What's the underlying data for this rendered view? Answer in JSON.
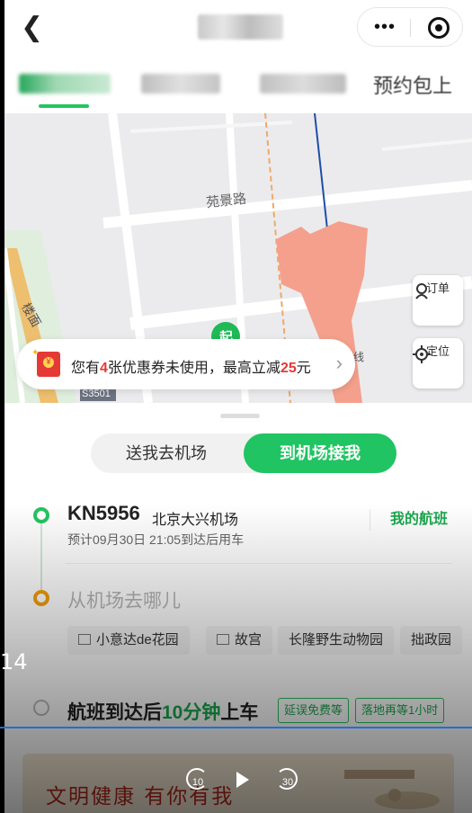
{
  "nav": {
    "back_icon": "back-arrow-icon",
    "more_icon": "more-dots-icon",
    "record_icon": "record-target-icon"
  },
  "tabs": [
    {
      "label": "",
      "active": true
    },
    {
      "label": "",
      "active": false
    },
    {
      "label": "",
      "active": false
    },
    {
      "label": "预约包上",
      "active": false
    }
  ],
  "map": {
    "road_label": "苑景路",
    "road_label_2": "楼面",
    "highway_label": "S3501",
    "line_label": "线",
    "start_marker": "起",
    "order_label": "订单",
    "locate_label": "定位"
  },
  "coupon": {
    "prefix": "您有",
    "count": "4",
    "middle": "张优惠券未使用，最高立减",
    "amount": "25",
    "suffix": "元"
  },
  "mode_switch": {
    "option_1": "送我去机场",
    "option_2": "到机场接我",
    "active": "到机场接我"
  },
  "flight": {
    "number": "KN5956",
    "airport": "北京大兴机场",
    "eta": "预计09月30日 21:05到达后用车",
    "my_flight_label": "我的航班"
  },
  "destination": {
    "placeholder": "从机场去哪儿",
    "suggestions": [
      "小意达de花园",
      "故宫",
      "长隆野生动物园",
      "拙政园"
    ]
  },
  "wait": {
    "prefix": "航班到达后",
    "minutes": "10分钟",
    "suffix": "上车",
    "tag_1": "延误免费等",
    "tag_2": "落地再等1小时"
  },
  "banner": {
    "text": "文明健康 有你有我"
  },
  "video": {
    "timecode": "14",
    "rewind_label": "10",
    "forward_label": "30"
  },
  "colors": {
    "accent_green": "#20c462",
    "coupon_red": "#e53935",
    "origin_orange": "#f59e0b"
  }
}
